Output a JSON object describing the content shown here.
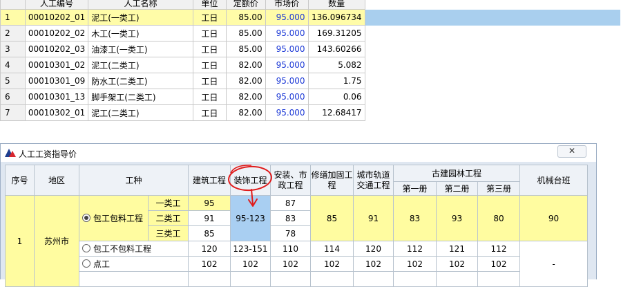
{
  "labor_table": {
    "columns": [
      "人工编号",
      "人工名称",
      "单位",
      "定额价",
      "市场价",
      "数量"
    ],
    "rows": [
      {
        "idx": "1",
        "code": "00010202_01",
        "name": "泥工(一类工)",
        "unit": "工日",
        "quota": "85.00",
        "market": "95.000",
        "qty": "136.096734"
      },
      {
        "idx": "2",
        "code": "00010202_02",
        "name": "木工(一类工)",
        "unit": "工日",
        "quota": "85.00",
        "market": "95.000",
        "qty": "169.31205"
      },
      {
        "idx": "3",
        "code": "00010202_03",
        "name": "油漆工(一类工)",
        "unit": "工日",
        "quota": "85.00",
        "market": "95.000",
        "qty": "143.60266"
      },
      {
        "idx": "4",
        "code": "00010301_02",
        "name": "泥工(二类工)",
        "unit": "工日",
        "quota": "82.00",
        "market": "95.000",
        "qty": "5.082"
      },
      {
        "idx": "5",
        "code": "00010301_09",
        "name": "防水工(二类工)",
        "unit": "工日",
        "quota": "82.00",
        "market": "95.000",
        "qty": "1.75"
      },
      {
        "idx": "6",
        "code": "00010301_13",
        "name": "脚手架工(二类工)",
        "unit": "工日",
        "quota": "82.00",
        "market": "95.000",
        "qty": "0.06"
      },
      {
        "idx": "7",
        "code": "00010302_01",
        "name": "泥工(二类工)",
        "unit": "工日",
        "quota": "82.00",
        "market": "95.000",
        "qty": "12.68417"
      }
    ]
  },
  "dialog": {
    "title": "人工工资指导价",
    "close_label": "✕",
    "headers": {
      "seq": "序号",
      "region": "地区",
      "trade": "工种",
      "building": "建筑工程",
      "decoration": "装饰工程",
      "install": "安装、市政工程",
      "repair": "修缮加固工程",
      "rail": "城市轨道交通工程",
      "garden": "古建园林工程",
      "vol1": "第一册",
      "vol2": "第二册",
      "vol3": "第三册",
      "machine": "机械台班"
    },
    "rows": {
      "seq": "1",
      "region": "苏州市",
      "all_inclusive": {
        "label": "包工包料工程",
        "selected": true,
        "grades": [
          {
            "grade": "一类工",
            "building": "95",
            "install": "87"
          },
          {
            "grade": "二类工",
            "building": "91",
            "install": "83"
          },
          {
            "grade": "三类工",
            "building": "85",
            "install": "78"
          }
        ],
        "decoration": "95-123",
        "repair": "85",
        "rail": "91",
        "vol1": "83",
        "vol2": "93",
        "vol3": "80",
        "machine": "90"
      },
      "labor_only": {
        "label": "包工不包料工程",
        "building": "120",
        "decoration": "123-151",
        "install": "110",
        "repair": "114",
        "rail": "120",
        "vol1": "112",
        "vol2": "121",
        "vol3": "112"
      },
      "day_labor": {
        "label": "点工",
        "building": "102",
        "decoration": "102",
        "install": "102",
        "repair": "102",
        "rail": "102",
        "vol1": "102",
        "vol2": "102",
        "vol3": "102"
      },
      "machine_other": "-"
    }
  },
  "colors": {
    "selected_row": "#fffca8",
    "selection_fill": "#a9cfee",
    "market_price_text": "#1a37d6",
    "highlight_cell": "#a9cff2",
    "annotation_red": "#e01b1b"
  }
}
